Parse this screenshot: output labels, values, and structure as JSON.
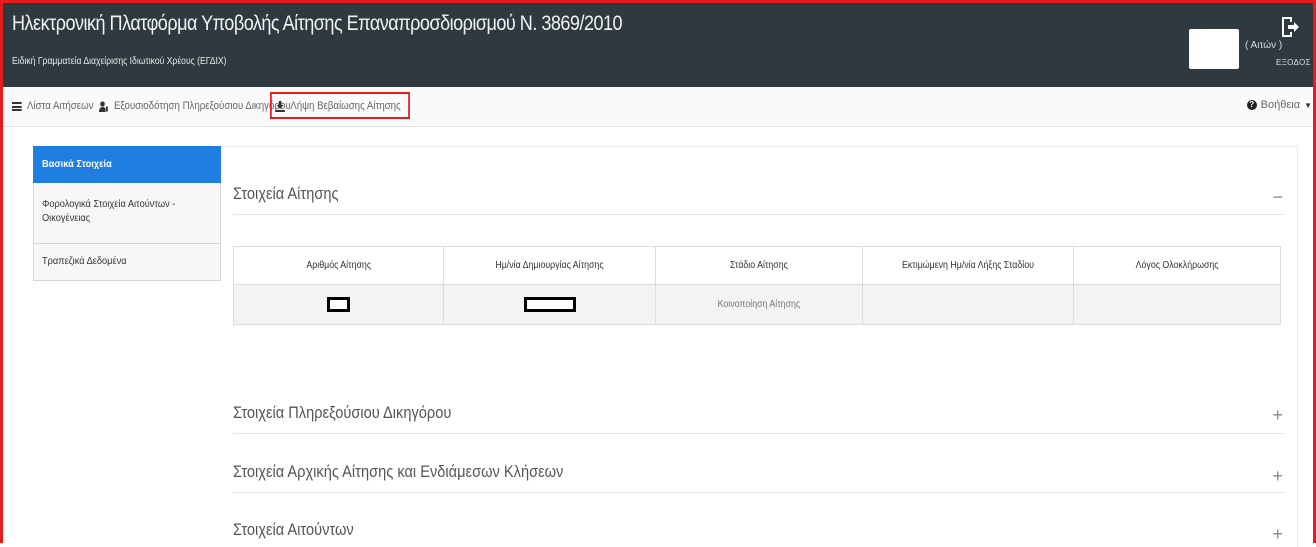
{
  "header": {
    "title": "Ηλεκτρονική Πλατφόρμα Υποβολής Αίτησης Επαναπροσδιορισμού Ν. 3869/2010",
    "subtitle": "Ειδική Γραμματεία Διαχείρισης Ιδιωτικού Χρέους (ΕΓΔΙΧ)",
    "user_role": "( Αιτών )",
    "logout_label": "ΕΞΟΔΟΣ"
  },
  "nav": {
    "items": [
      {
        "label": "Λίστα Αιτήσεων",
        "icon": "list-icon"
      },
      {
        "label": "Εξουσιοδότηση Πληρεξούσιου Δικηγόρου",
        "icon": "user-key-icon"
      },
      {
        "label": "Λήψη Βεβαίωσης Αίτησης",
        "icon": "download-icon"
      }
    ],
    "help_label": "Βοήθεια"
  },
  "sidebar": {
    "items": [
      {
        "label": "Βασικά Στοιχεία"
      },
      {
        "label": "Φορολογικά Στοιχεία Αιτούντων - Οικογένειας"
      },
      {
        "label": "Τραπεζικά Δεδομένα"
      }
    ]
  },
  "sections": [
    {
      "title": "Στοιχεία Αίτησης",
      "toggle": "−"
    },
    {
      "title": "Στοιχεία Πληρεξούσιου Δικηγόρου",
      "toggle": "+"
    },
    {
      "title": "Στοιχεία Αρχικής Αίτησης και Ενδιάμεσων Κλήσεων",
      "toggle": "+"
    },
    {
      "title": "Στοιχεία Αιτούντων",
      "toggle": "+"
    }
  ],
  "table": {
    "headers": [
      "Αριθμός Αίτησης",
      "Ημ/νία Δημιουργίας Αίτησης",
      "Στάδιο Αίτησης",
      "Εκτιμώμενη Ημ/νία Λήξης Σταδίου",
      "Λόγος Ολοκλήρωσης"
    ],
    "row": {
      "stage": "Κοινοποίηση Αίτησης"
    }
  },
  "colors": {
    "header_bg": "#2e3a3f",
    "accent": "#1e7fe0",
    "highlight": "#e41c1c"
  }
}
